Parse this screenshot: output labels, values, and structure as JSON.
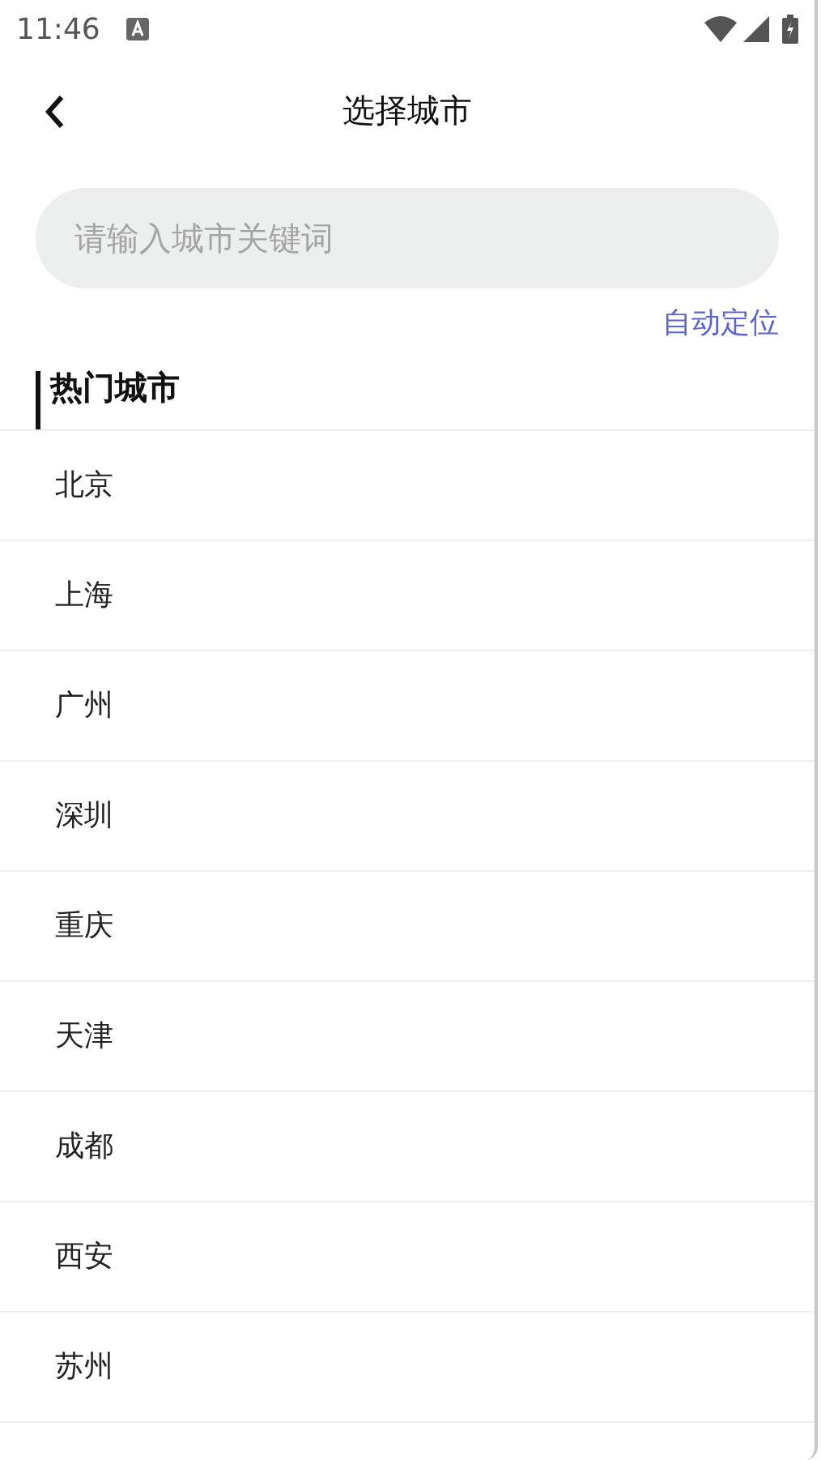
{
  "status_bar": {
    "time": "11:46"
  },
  "header": {
    "title": "选择城市"
  },
  "search": {
    "placeholder": "请输入城市关键词"
  },
  "auto_locate": "自动定位",
  "section": {
    "title": "热门城市"
  },
  "cities": [
    {
      "name": "北京"
    },
    {
      "name": "上海"
    },
    {
      "name": "广州"
    },
    {
      "name": "深圳"
    },
    {
      "name": "重庆"
    },
    {
      "name": "天津"
    },
    {
      "name": "成都"
    },
    {
      "name": "西安"
    },
    {
      "name": "苏州"
    }
  ]
}
